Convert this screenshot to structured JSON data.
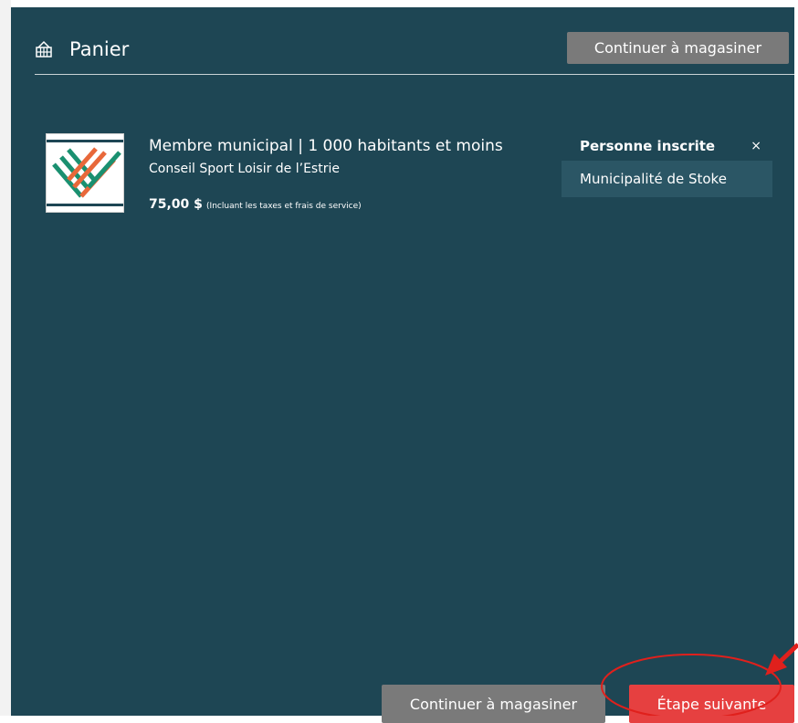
{
  "header": {
    "title": "Panier",
    "icon": "basket-icon",
    "continue_label": "Continuer à magasiner"
  },
  "item": {
    "title": "Membre municipal | 1 000 habitants et moins",
    "organization": "Conseil Sport Loisir de l’Estrie",
    "price": "75,00 $",
    "price_note": "(Incluant les taxes et frais de service)",
    "logo_colors": [
      "#1a9070",
      "#e8683a"
    ]
  },
  "registrant": {
    "label": "Personne inscrite",
    "close_symbol": "×",
    "name": "Municipalité de Stoke"
  },
  "footer": {
    "continue_label": "Continuer à magasiner",
    "next_label": "Étape suivante"
  },
  "colors": {
    "panel_bg": "#1e4654",
    "grey_button": "#7a7a7a",
    "next_button": "#e64040",
    "annotation": "#e0201c"
  }
}
